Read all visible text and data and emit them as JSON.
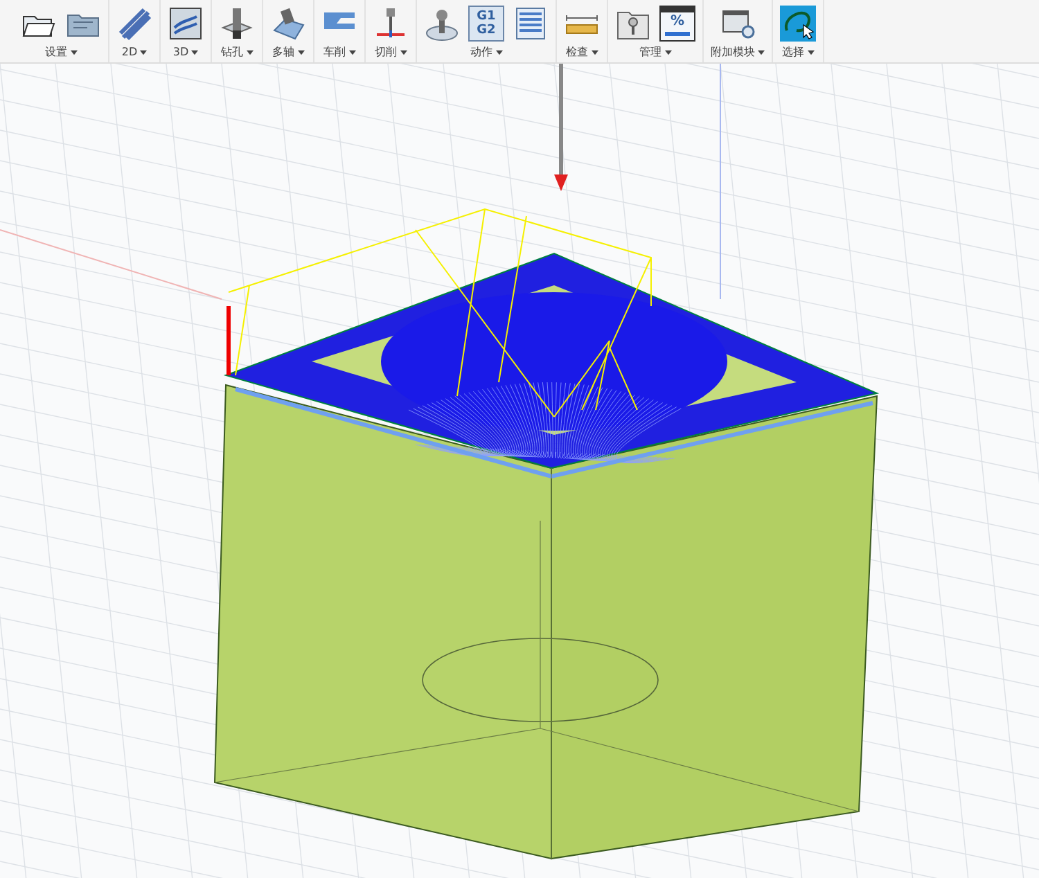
{
  "toolbar": {
    "groups": [
      {
        "label": "设置",
        "icons": [
          {
            "kind": "open-folder"
          },
          {
            "kind": "folder"
          }
        ]
      },
      {
        "label": "2D",
        "icons": [
          {
            "kind": "contour"
          }
        ]
      },
      {
        "label": "3D",
        "icons": [
          {
            "kind": "surface"
          }
        ]
      },
      {
        "label": "钻孔",
        "icons": [
          {
            "kind": "drill"
          }
        ]
      },
      {
        "label": "多轴",
        "icons": [
          {
            "kind": "multiaxis"
          }
        ]
      },
      {
        "label": "车削",
        "icons": [
          {
            "kind": "turning"
          }
        ]
      },
      {
        "label": "切削",
        "icons": [
          {
            "kind": "cutting"
          }
        ]
      },
      {
        "label": "动作",
        "icons": [
          {
            "kind": "joystick"
          },
          {
            "kind": "gcode",
            "lines": [
              "G1",
              "G2"
            ]
          },
          {
            "kind": "sheet"
          }
        ]
      },
      {
        "label": "检查",
        "icons": [
          {
            "kind": "ruler"
          }
        ]
      },
      {
        "label": "管理",
        "icons": [
          {
            "kind": "tool-library"
          },
          {
            "kind": "post",
            "text": "%"
          }
        ]
      },
      {
        "label": "附加模块",
        "icons": [
          {
            "kind": "addin"
          }
        ]
      },
      {
        "label": "选择",
        "icons": [
          {
            "kind": "lasso"
          }
        ]
      }
    ]
  }
}
